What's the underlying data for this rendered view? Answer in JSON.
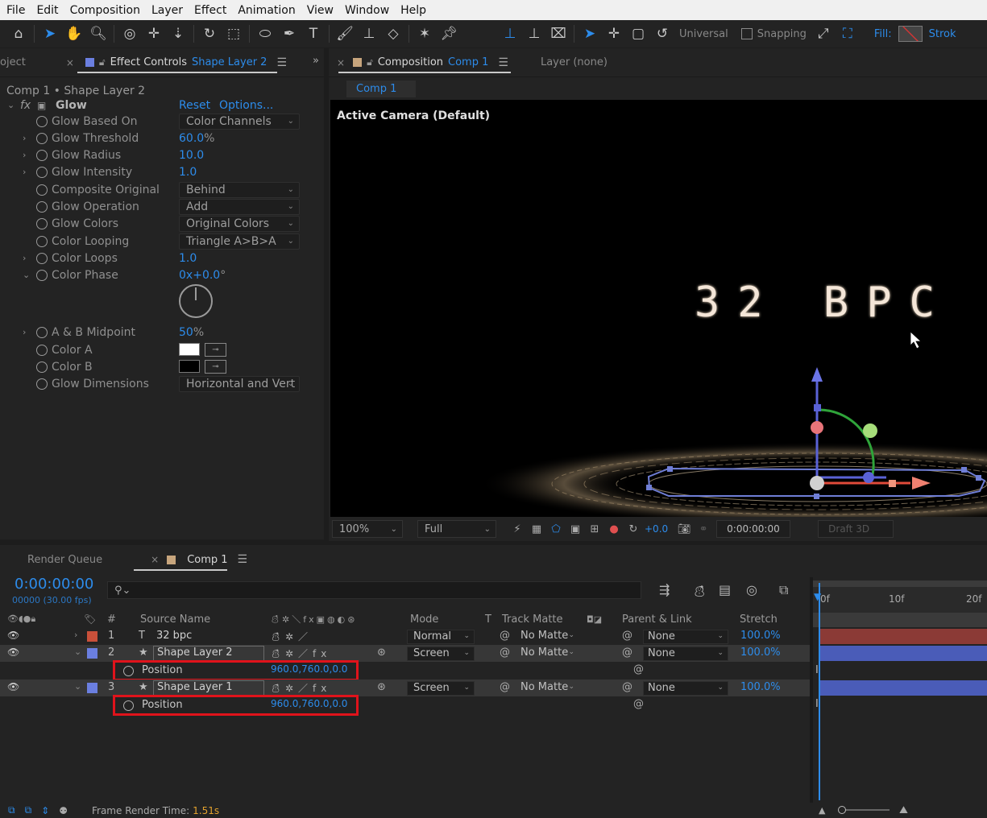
{
  "menu": [
    "File",
    "Edit",
    "Composition",
    "Layer",
    "Effect",
    "Animation",
    "View",
    "Window",
    "Help"
  ],
  "toolbar": {
    "universal_label": "Universal",
    "snapping_label": "Snapping",
    "fill_label": "Fill:",
    "stroke_label": "Strok"
  },
  "effect_panel": {
    "project_tab": "oject",
    "tab_label": "Effect Controls",
    "tab_layer": "Shape Layer 2",
    "header": "Comp 1 • Shape Layer 2",
    "effect_name": "Glow",
    "reset_label": "Reset",
    "options_label": "Options...",
    "props": {
      "glow_based_on": {
        "name": "Glow Based On",
        "value": "Color Channels"
      },
      "glow_threshold": {
        "name": "Glow Threshold",
        "value": "60.0",
        "unit": "%"
      },
      "glow_radius": {
        "name": "Glow Radius",
        "value": "10.0"
      },
      "glow_intensity": {
        "name": "Glow Intensity",
        "value": "1.0"
      },
      "composite_original": {
        "name": "Composite Original",
        "value": "Behind"
      },
      "glow_operation": {
        "name": "Glow Operation",
        "value": "Add"
      },
      "glow_colors": {
        "name": "Glow Colors",
        "value": "Original Colors"
      },
      "color_looping": {
        "name": "Color Looping",
        "value": "Triangle A>B>A"
      },
      "color_loops": {
        "name": "Color Loops",
        "value": "1.0"
      },
      "color_phase": {
        "name": "Color Phase",
        "value": "0",
        "value2": "x+0.0",
        "unit": "°"
      },
      "ab_midpoint": {
        "name": "A & B Midpoint",
        "value": "50",
        "unit": "%"
      },
      "color_a": {
        "name": "Color A",
        "color": "#ffffff"
      },
      "color_b": {
        "name": "Color B",
        "color": "#000000"
      },
      "glow_dimensions": {
        "name": "Glow Dimensions",
        "value": "Horizontal and Vert"
      }
    }
  },
  "comp_panel": {
    "tab_label": "Composition",
    "tab_comp": "Comp 1",
    "layer_tab": "Layer (none)",
    "subtab": "Comp 1",
    "camera_label": "Active Camera (Default)",
    "viewer_text": "32 BPC",
    "zoom": "100%",
    "resolution": "Full",
    "exposure": "+0.0",
    "timecode": "0:00:00:00",
    "renderer": "Draft 3D"
  },
  "timeline": {
    "render_queue_tab": "Render Queue",
    "comp_tab": "Comp 1",
    "current_time": "0:00:00:00",
    "frame_fps": "00000 (30.00 fps)",
    "search_placeholder": "",
    "headers": {
      "num": "#",
      "source_name": "Source Name",
      "mode": "Mode",
      "t": "T",
      "track_matte": "Track Matte",
      "parent_link": "Parent & Link",
      "stretch": "Stretch"
    },
    "ruler": [
      "0f",
      "10f",
      "20f"
    ],
    "layers": [
      {
        "num": "1",
        "name": "32 bpc",
        "mode": "Normal",
        "matte": "No Matte",
        "parent": "None",
        "stretch": "100.0%",
        "color": "#c9503a",
        "bar": "#8b3a36"
      },
      {
        "num": "2",
        "name": "Shape Layer 2",
        "mode": "Screen",
        "matte": "No Matte",
        "parent": "None",
        "stretch": "100.0%",
        "color": "#6b7fe0",
        "bar": "#4a5cb8",
        "prop_name": "Position",
        "prop_value": "960.0,760.0,0.0"
      },
      {
        "num": "3",
        "name": "Shape Layer 1",
        "mode": "Screen",
        "matte": "No Matte",
        "parent": "None",
        "stretch": "100.0%",
        "color": "#6b7fe0",
        "bar": "#4a5cb8",
        "prop_name": "Position",
        "prop_value": "960.0,760.0,0.0"
      }
    ]
  },
  "status": {
    "label": "Frame Render Time:",
    "value": "1.51s"
  },
  "colors": {
    "accent": "#2d8ceb",
    "highlight_box": "#e0131b"
  }
}
